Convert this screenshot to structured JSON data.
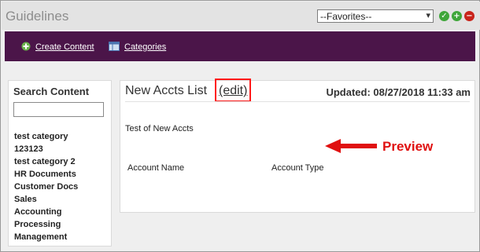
{
  "app": {
    "title": "Guidelines"
  },
  "favorites": {
    "selected": "--Favorites--"
  },
  "actions": {
    "approve": "✓",
    "add": "+",
    "remove": "−"
  },
  "nav": {
    "create": "Create Content",
    "categories": "Categories"
  },
  "sidebar": {
    "title": "Search Content",
    "search_value": "",
    "categories": [
      "test category",
      "123123",
      "test category 2",
      "HR Documents",
      "Customer Docs",
      "Sales",
      "Accounting",
      "Processing",
      "Management"
    ]
  },
  "content": {
    "title": "New Accts List",
    "edit": "(edit)",
    "updated": "Updated: 08/27/2018 11:33 am",
    "description": "Test of New Accts",
    "columns": [
      "Account Name",
      "Account Type"
    ]
  },
  "annotation": {
    "label": "Preview",
    "color": "#e01010"
  },
  "colors": {
    "nav_bg": "#4b1549",
    "green": "#3fa63a",
    "red": "#c8241b"
  }
}
